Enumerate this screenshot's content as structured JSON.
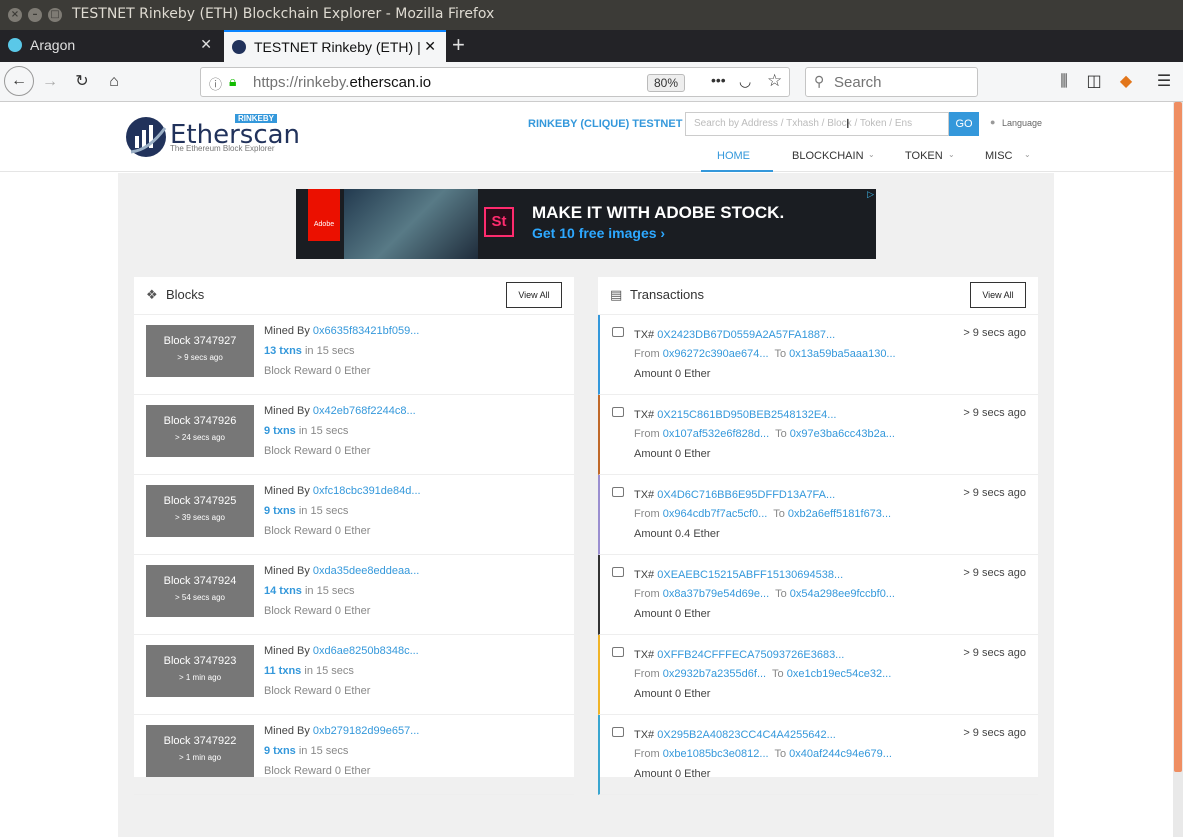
{
  "window": {
    "title": "TESTNET Rinkeby (ETH) Blockchain Explorer - Mozilla Firefox"
  },
  "tabs": [
    {
      "label": "Aragon"
    },
    {
      "label": "TESTNET Rinkeby (ETH) |"
    }
  ],
  "toolbar": {
    "url_prefix": "https://rinkeby.",
    "url_domain": "etherscan.io",
    "zoom": "80%",
    "search_placeholder": "Search"
  },
  "site": {
    "logo_text": "Etherscan",
    "logo_sub": "The Ethereum Block Explorer",
    "logo_tag": "RINKEBY",
    "network": "RINKEBY (CLIQUE) TESTNET",
    "search_placeholder": "Search by Address / Txhash / Block / Token / Ens",
    "go": "GO",
    "language": "Language",
    "menu": [
      "HOME",
      "BLOCKCHAIN",
      "TOKEN",
      "MISC"
    ]
  },
  "ad": {
    "brand": "Adobe",
    "st": "St",
    "headline": "MAKE IT WITH ADOBE STOCK.",
    "cta": "Get 10 free images ›"
  },
  "blocks": {
    "title": "Blocks",
    "view_all": "View All",
    "items": [
      {
        "number": "Block 3747927",
        "age": "> 9 secs ago",
        "mined_by_label": "Mined By",
        "miner": "0x6635f83421bf059...",
        "txns": "13 txns",
        "in": "in 15 secs",
        "reward": "Block Reward 0 Ether"
      },
      {
        "number": "Block 3747926",
        "age": "> 24 secs ago",
        "mined_by_label": "Mined By",
        "miner": "0x42eb768f2244c8...",
        "txns": "9 txns",
        "in": "in 15 secs",
        "reward": "Block Reward 0 Ether"
      },
      {
        "number": "Block 3747925",
        "age": "> 39 secs ago",
        "mined_by_label": "Mined By",
        "miner": "0xfc18cbc391de84d...",
        "txns": "9 txns",
        "in": "in 15 secs",
        "reward": "Block Reward 0 Ether"
      },
      {
        "number": "Block 3747924",
        "age": "> 54 secs ago",
        "mined_by_label": "Mined By",
        "miner": "0xda35dee8eddeaa...",
        "txns": "14 txns",
        "in": "in 15 secs",
        "reward": "Block Reward 0 Ether"
      },
      {
        "number": "Block 3747923",
        "age": "> 1 min ago",
        "mined_by_label": "Mined By",
        "miner": "0xd6ae8250b8348c...",
        "txns": "11 txns",
        "in": "in 15 secs",
        "reward": "Block Reward 0 Ether"
      },
      {
        "number": "Block 3747922",
        "age": "> 1 min ago",
        "mined_by_label": "Mined By",
        "miner": "0xb279182d99e657...",
        "txns": "9 txns",
        "in": "in 15 secs",
        "reward": "Block Reward 0 Ether"
      }
    ]
  },
  "transactions": {
    "title": "Transactions",
    "view_all": "View All",
    "items": [
      {
        "tx_label": "TX#",
        "hash": "0X2423DB67D0559A2A57FA1887...",
        "from_label": "From",
        "from": "0x96272c390ae674...",
        "to_label": "To",
        "to": "0x13a59ba5aaa130...",
        "amount": "Amount 0 Ether",
        "ago": "> 9 secs ago",
        "color": "#3498db"
      },
      {
        "tx_label": "TX#",
        "hash": "0X215C861BD950BEB2548132E4...",
        "from_label": "From",
        "from": "0x107af532e6f828d...",
        "to_label": "To",
        "to": "0x97e3ba6cc43b2a...",
        "amount": "Amount 0 Ether",
        "ago": "> 9 secs ago",
        "color": "#c0692a"
      },
      {
        "tx_label": "TX#",
        "hash": "0X4D6C716BB6E95DFFD13A7FA...",
        "from_label": "From",
        "from": "0x964cdb7f7ac5cf0...",
        "to_label": "To",
        "to": "0xb2a6eff5181f673...",
        "amount": "Amount 0.4 Ether",
        "ago": "> 9 secs ago",
        "color": "#9b8fd0"
      },
      {
        "tx_label": "TX#",
        "hash": "0XEAEBC15215ABFF15130694538...",
        "from_label": "From",
        "from": "0x8a37b79e54d69e...",
        "to_label": "To",
        "to": "0x54a298ee9fccbf0...",
        "amount": "Amount 0 Ether",
        "ago": "> 9 secs ago",
        "color": "#333333"
      },
      {
        "tx_label": "TX#",
        "hash": "0XFFB24CFFFECA75093726E3683...",
        "from_label": "From",
        "from": "0x2932b7a2355d6f...",
        "to_label": "To",
        "to": "0xe1cb19ec54ce32...",
        "amount": "Amount 0 Ether",
        "ago": "> 9 secs ago",
        "color": "#f0b429"
      },
      {
        "tx_label": "TX#",
        "hash": "0X295B2A40823CC4C4A4255642...",
        "from_label": "From",
        "from": "0xbe1085bc3e0812...",
        "to_label": "To",
        "to": "0x40af244c94e679...",
        "amount": "Amount 0 Ether",
        "ago": "> 9 secs ago",
        "color": "#3aa6d0"
      }
    ]
  }
}
